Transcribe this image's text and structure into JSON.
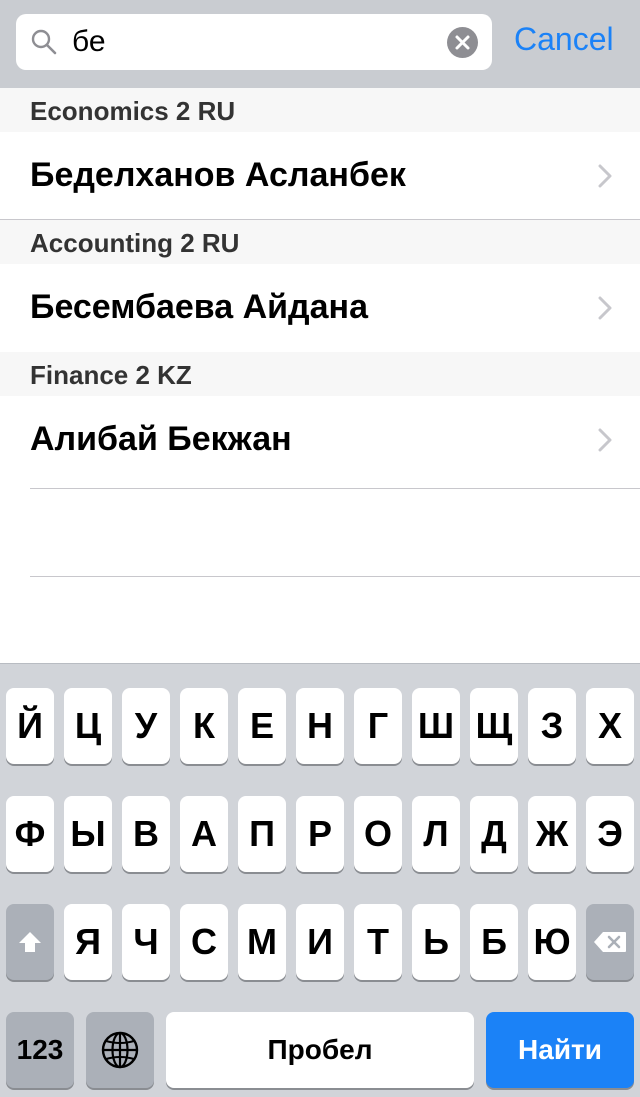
{
  "search": {
    "query": "бе",
    "cancel_label": "Cancel"
  },
  "results": [
    {
      "section": "Economics 2 RU",
      "name": "Беделханов Асланбек"
    },
    {
      "section": "Accounting 2 RU",
      "name": "Бесембаева Айдана"
    },
    {
      "section": "Finance 2 KZ",
      "name": "Алибай Бекжан"
    }
  ],
  "keyboard": {
    "row1": [
      "Й",
      "Ц",
      "У",
      "К",
      "Е",
      "Н",
      "Г",
      "Ш",
      "Щ",
      "З",
      "Х"
    ],
    "row2": [
      "Ф",
      "Ы",
      "В",
      "А",
      "П",
      "Р",
      "О",
      "Л",
      "Д",
      "Ж",
      "Э"
    ],
    "row3": [
      "Я",
      "Ч",
      "С",
      "М",
      "И",
      "Т",
      "Ь",
      "Б",
      "Ю"
    ],
    "numbers_label": "123",
    "space_label": "Пробел",
    "return_label": "Найти"
  },
  "colors": {
    "accent": "#1b82f7",
    "search_bar_bg": "#c9ccd1",
    "keyboard_bg": "#d1d4d9"
  },
  "icons": [
    "search-icon",
    "clear-icon",
    "chevron-right-icon",
    "shift-icon",
    "backspace-icon",
    "globe-icon"
  ]
}
